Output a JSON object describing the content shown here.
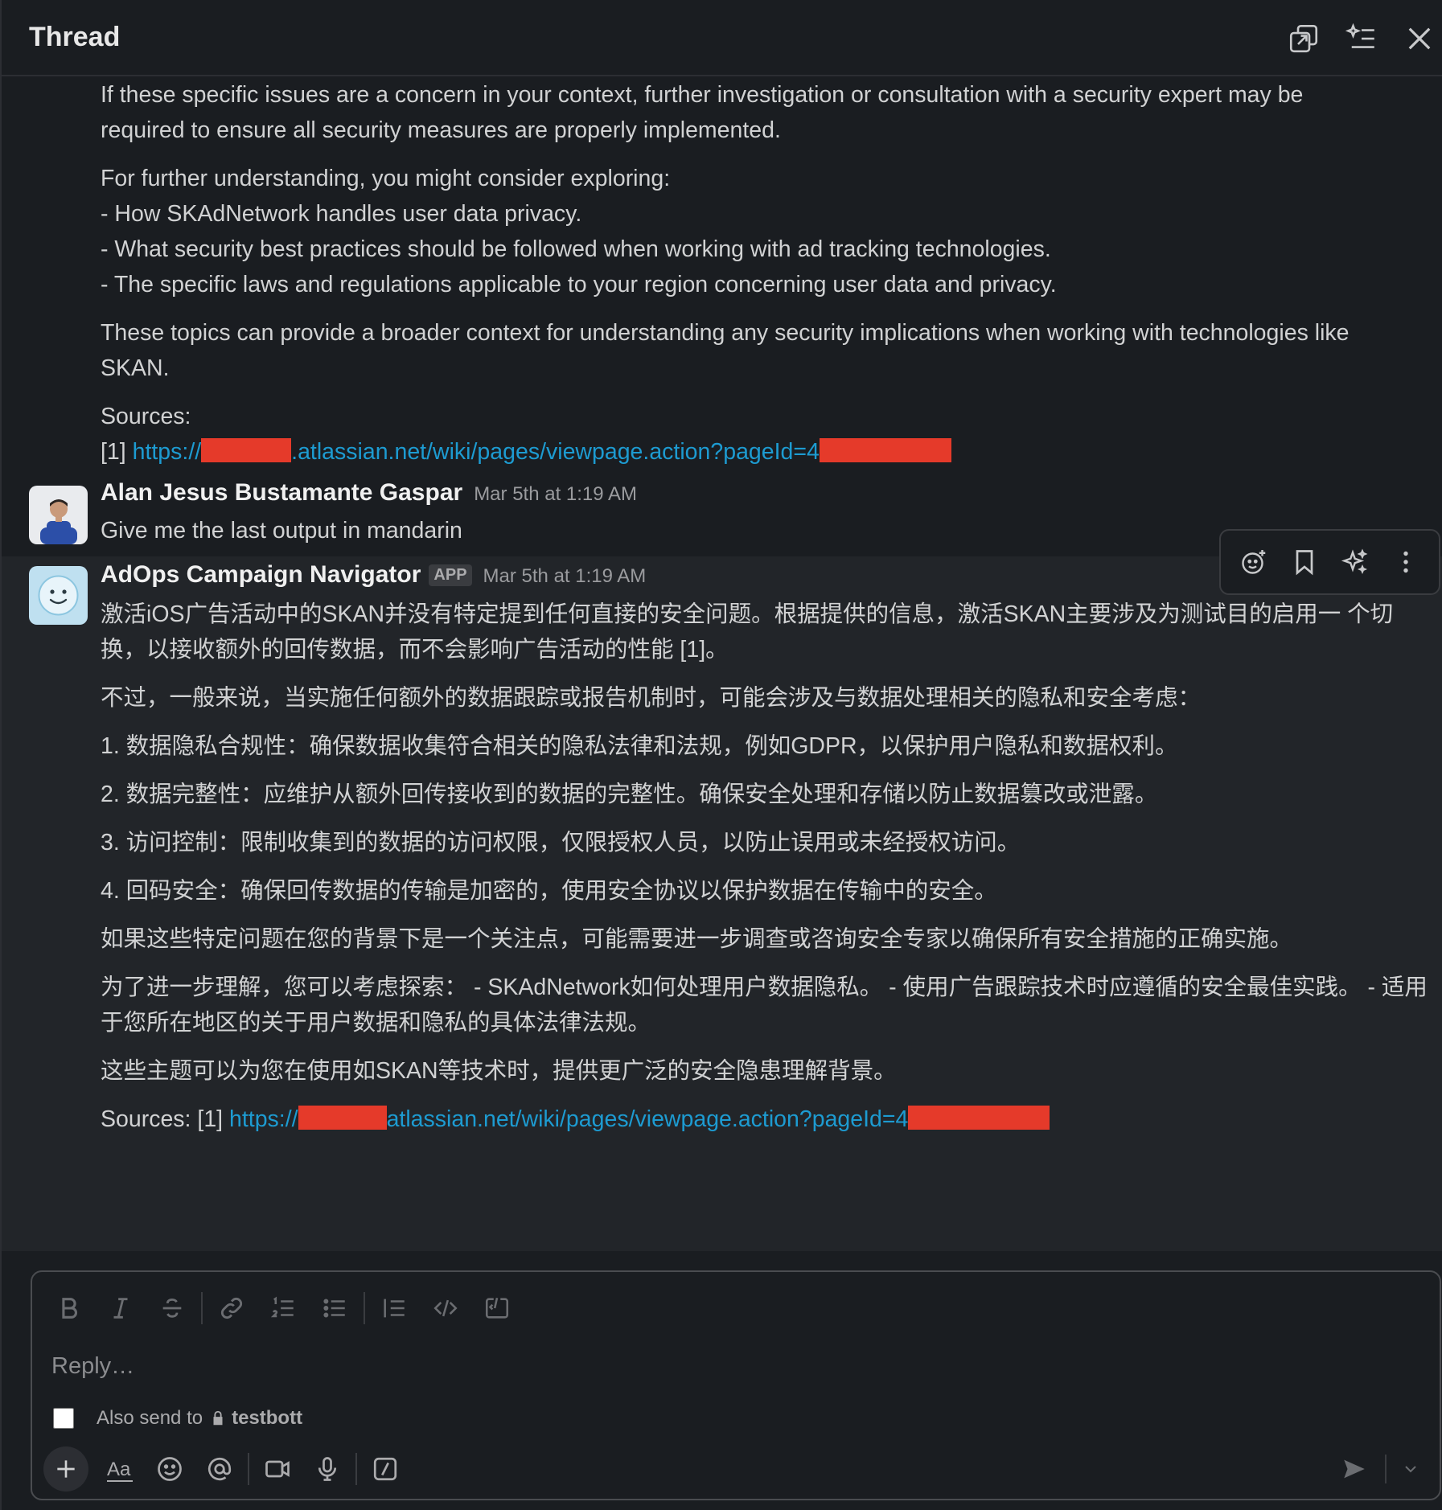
{
  "header": {
    "title": "Thread",
    "icons": [
      "open-in-window-icon",
      "ai-summary-icon",
      "close-icon"
    ]
  },
  "first_message_tail": {
    "para1": [
      "If these specific issues are a concern in your context, further investigation or consultation with a security expert may be",
      "required to ensure all security measures are properly implemented."
    ],
    "para2": [
      "For further understanding, you might consider exploring:",
      "- How SKAdNetwork handles user data privacy.",
      "- What security best practices should be followed when working with ad tracking technologies.",
      "- The specific laws and regulations applicable to your region concerning user data and privacy."
    ],
    "para3": [
      "These topics can provide a broader context for understanding any security implications when working with technologies like",
      "SKAN."
    ],
    "sources_label": "Sources:",
    "source_index": "[1]",
    "source_prefix": "https://",
    "source_mid": ".atlassian.net/wiki/pages/viewpage.action?pageId=4"
  },
  "user_message": {
    "author": "Alan Jesus Bustamante Gaspar",
    "timestamp": "Mar 5th at 1:19 AM",
    "text": "Give me the last output in mandarin"
  },
  "bot_message": {
    "author": "AdOps Campaign Navigator",
    "badge": "APP",
    "timestamp": "Mar 5th at 1:19 AM",
    "para1": [
      "激活iOS广告活动中的SKAN并没有特定提到任何直接的安全问题。根据提供的信息，激活SKAN主要涉及为测试目的启用一",
      "个切换，以接收额外的回传数据，而不会影响广告活动的性能 [1]。"
    ],
    "para2": "不过，一般来说，当实施任何额外的数据跟踪或报告机制时，可能会涉及与数据处理相关的隐私和安全考虑：",
    "list": [
      "1. 数据隐私合规性：确保数据收集符合相关的隐私法律和法规，例如GDPR，以保护用户隐私和数据权利。",
      "2. 数据完整性：应维护从额外回传接收到的数据的完整性。确保安全处理和存储以防止数据篡改或泄露。",
      "3. 访问控制：限制收集到的数据的访问权限，仅限授权人员，以防止误用或未经授权访问。",
      "4. 回码安全：确保回传数据的传输是加密的，使用安全协议以保护数据在传输中的安全。"
    ],
    "para3": "如果这些特定问题在您的背景下是一个关注点，可能需要进一步调查或咨询安全专家以确保所有安全措施的正确实施。",
    "para4": [
      "为了进一步理解，您可以考虑探索：",
      "- SKAdNetwork如何处理用户数据隐私。",
      "- 使用广告跟踪技术时应遵循的安全最佳实践。",
      "- 适用于您所在地区的关于用户数据和隐私的具体法律法规。"
    ],
    "para5": "这些主题可以为您在使用如SKAN等技术时，提供更广泛的安全隐患理解背景。",
    "sources_label": "Sources:",
    "source_index": "[1]",
    "source_prefix": "https://",
    "source_mid": "atlassian.net/wiki/pages/viewpage.action?pageId=4"
  },
  "message_actions": [
    "add-reaction-icon",
    "save-bookmark-icon",
    "ai-sparkle-icon",
    "more-options-icon"
  ],
  "composer": {
    "placeholder": "Reply…",
    "also_send_label": "Also send to",
    "channel": "testbott"
  },
  "colors": {
    "background": "#1a1d21",
    "link": "#1d9bd1",
    "redaction": "#e53a2a"
  }
}
